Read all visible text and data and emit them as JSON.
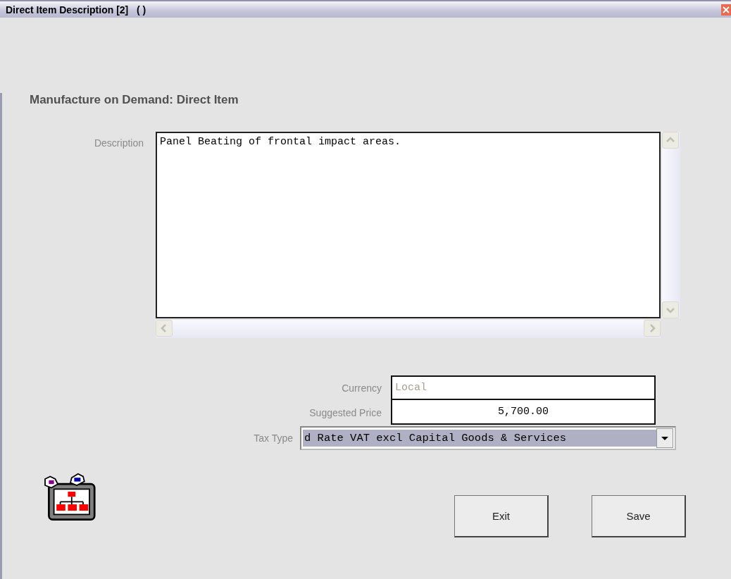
{
  "window": {
    "title": "Direct Item Description [2]   ( )"
  },
  "heading": "Manufacture on Demand: Direct Item",
  "description": {
    "label": "Description",
    "value": "Panel Beating of frontal impact areas."
  },
  "fields": [
    {
      "label": "Currency",
      "value": "Local",
      "disabled": true,
      "kind": "text"
    },
    {
      "label": "Suggested Price",
      "value": "5,700.00",
      "disabled": false,
      "kind": "number"
    }
  ],
  "tax_type": {
    "label": "Tax Type",
    "value": "d Rate VAT excl Capital Goods & Services",
    "highlighted": true
  },
  "buttons": [
    "Exit",
    "Save"
  ]
}
